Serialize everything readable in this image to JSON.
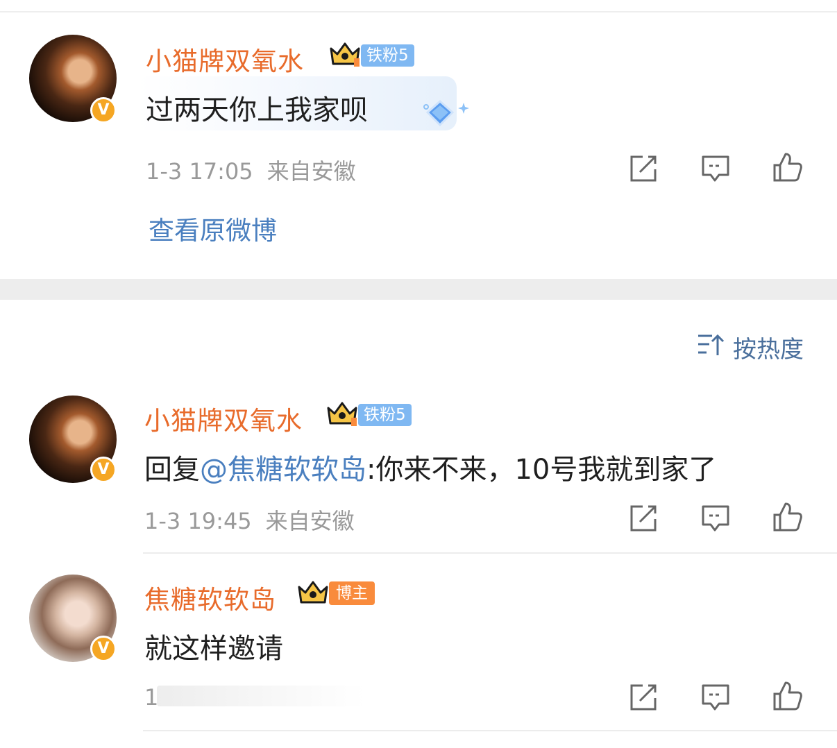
{
  "post": {
    "user": {
      "name": "小猫牌双氧水",
      "fan_badge": "铁粉5"
    },
    "content": "过两天你上我家呗",
    "date": "1-3 17:05",
    "source": "来自安徽",
    "view_original": "查看原微博"
  },
  "sort": {
    "label": "按热度"
  },
  "comments": [
    {
      "user": {
        "name": "小猫牌双氧水",
        "fan_badge": "铁粉5"
      },
      "reply_prefix": "回复",
      "mention": "@焦糖软软岛",
      "text": ":你来不来，10号我就到家了",
      "date": "1-3 19:45",
      "source": "来自安徽"
    },
    {
      "user": {
        "name": "焦糖软软岛",
        "role_badge": "博主"
      },
      "text": "就这样邀请",
      "date": "1"
    }
  ],
  "colors": {
    "username": "#e86b2b",
    "link": "#4a7fbf",
    "fan_badge": "#7fb8f2",
    "role_badge": "#f98b3c",
    "meta": "#999999"
  },
  "icons": [
    "crown-icon",
    "verified-v-icon",
    "share-icon",
    "comment-icon",
    "like-icon",
    "sort-icon",
    "diamond-sticker-icon"
  ]
}
